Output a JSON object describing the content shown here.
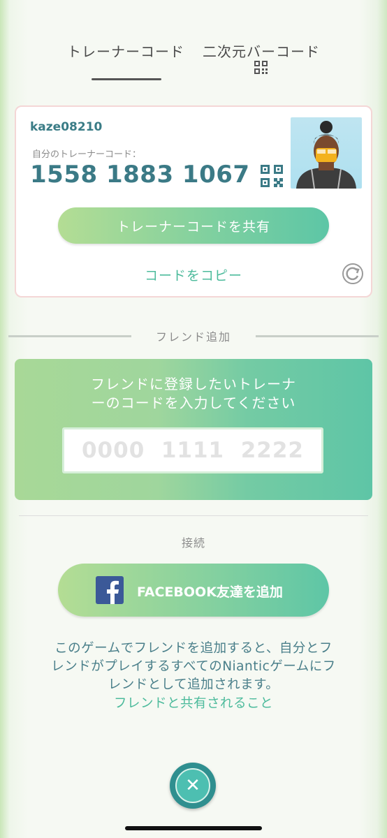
{
  "tabs": [
    {
      "label": "トレーナーコード",
      "active": true
    },
    {
      "label": "二次元バーコード",
      "icon": "qr-code-icon"
    }
  ],
  "trainer": {
    "username": "kaze08210",
    "code_label": "自分のトレーナーコード：",
    "code": "1558 1883 1067",
    "share_label": "トレーナーコードを共有",
    "copy_label": "コードをコピー"
  },
  "friend_add": {
    "title": "フレンド追加",
    "prompt_line1": "フレンドに登録したいトレーナ",
    "prompt_line2": "ーのコードを入力してください",
    "input_placeholder": "0000  1111  2222",
    "input_value": ""
  },
  "connect": {
    "title": "接続",
    "facebook_label": "FACEBOOK友達を追加"
  },
  "info": {
    "line1": "このゲームでフレンドを追加すると、自分とフ",
    "line2": "レンドがプレイするすべてのNianticゲームにフ",
    "line3": "レンドとして追加されます。",
    "link": "フレンドと共有されること"
  },
  "colors": {
    "accent": "#4dbb9c",
    "teal_text": "#3b7a86",
    "facebook": "#3b5998"
  }
}
